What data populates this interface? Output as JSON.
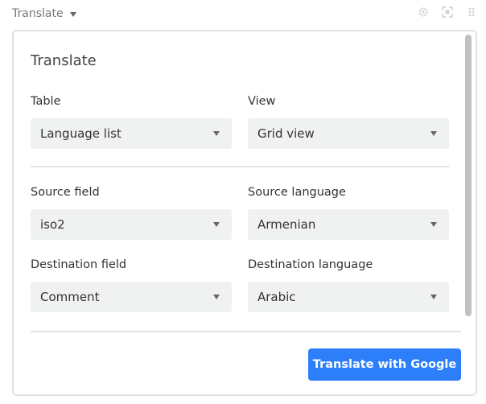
{
  "header": {
    "title": "Translate",
    "icons": [
      "gear-icon",
      "fullscreen-icon",
      "drag-handle-icon"
    ]
  },
  "panel": {
    "title": "Translate",
    "table": {
      "label": "Table",
      "value": "Language list"
    },
    "view": {
      "label": "View",
      "value": "Grid view"
    },
    "source_field": {
      "label": "Source field",
      "value": "iso2"
    },
    "source_language": {
      "label": "Source language",
      "value": "Armenian"
    },
    "destination_field": {
      "label": "Destination field",
      "value": "Comment"
    },
    "destination_language": {
      "label": "Destination language",
      "value": "Arabic"
    },
    "action_label": "Translate with Google"
  },
  "colors": {
    "primary": "#2d7ff9",
    "select_bg": "#f0f1f1",
    "border": "#e1e1e1"
  }
}
